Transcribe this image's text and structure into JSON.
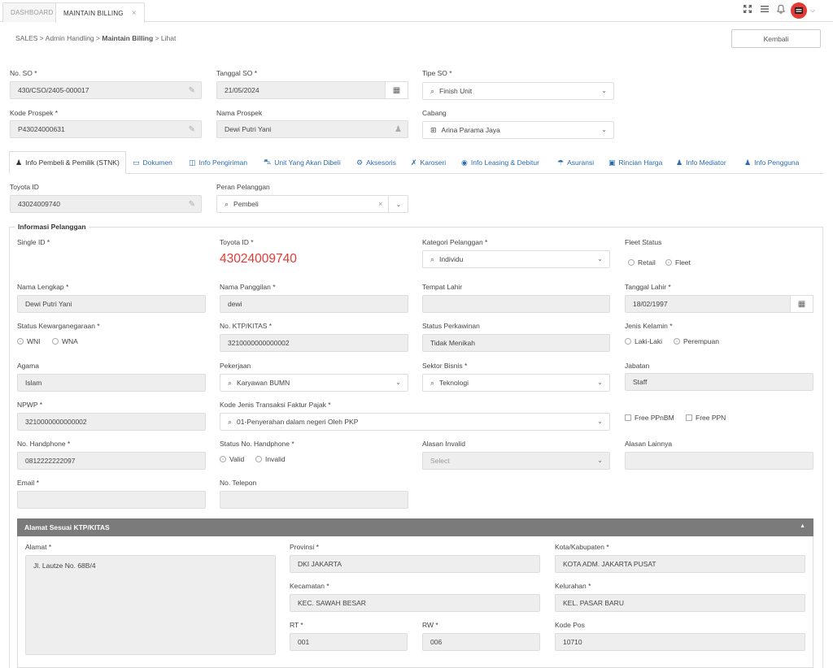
{
  "topbar": {
    "tabs": [
      {
        "label": "DASHBOARD"
      },
      {
        "label": "MAINTAIN BILLING",
        "close": "×"
      }
    ]
  },
  "breadcrumb": {
    "parts": [
      "SALES",
      "Admin Handling",
      "Maintain Billing",
      "Lihat"
    ],
    "sep": ">"
  },
  "actions": {
    "back_label": "Kembali"
  },
  "header": {
    "no_so": {
      "label": "No. SO *",
      "value": "430/CSO/2405-000017"
    },
    "tanggal_so": {
      "label": "Tanggal SO *",
      "value": "21/05/2024"
    },
    "tipe_so": {
      "label": "Tipe SO *",
      "value": "Finish Unit"
    },
    "kode_prospek": {
      "label": "Kode Prospek *",
      "value": "P43024000631"
    },
    "nama_prospek": {
      "label": "Nama Prospek",
      "value": "Dewi Putri Yani"
    },
    "cabang": {
      "label": "Cabang",
      "value": "Arina Parama Jaya"
    }
  },
  "tabs": [
    {
      "label": "Info Pembeli & Pemilik (STNK)",
      "icon": "user-icon"
    },
    {
      "label": "Dokumen",
      "icon": "folder-icon"
    },
    {
      "label": "Info Pengiriman",
      "icon": "map-icon"
    },
    {
      "label": "Unit Yang Akan Dibeli",
      "icon": "car-icon"
    },
    {
      "label": "Aksesoris",
      "icon": "gears-icon"
    },
    {
      "label": "Karoseri",
      "icon": "wrench-icon"
    },
    {
      "label": "Info Leasing & Debitur",
      "icon": "eye-icon"
    },
    {
      "label": "Asuransi",
      "icon": "umbrella-icon"
    },
    {
      "label": "Rincian Harga",
      "icon": "money-icon"
    },
    {
      "label": "Info Mediator",
      "icon": "users-icon"
    },
    {
      "label": "Info Pengguna",
      "icon": "user-icon"
    }
  ],
  "toyota": {
    "toyota_id": {
      "label": "Toyota ID",
      "value": "43024009740"
    },
    "peran": {
      "label": "Peran Pelanggan",
      "value": "Pembeli",
      "clear": "×"
    }
  },
  "info_pelanggan": {
    "legend": "Informasi Pelanggan",
    "single_id": {
      "label": "Single ID *"
    },
    "toyota_id": {
      "label": "Toyota ID *",
      "value": "43024009740"
    },
    "kategori": {
      "label": "Kategori Pelanggan *",
      "value": "Individu"
    },
    "fleet_status": {
      "label": "Fleet Status",
      "options": [
        "Retail",
        "Fleet"
      ],
      "selected": "Fleet"
    },
    "nama_lengkap": {
      "label": "Nama Lengkap *",
      "value": "Dewi Putri Yani"
    },
    "nama_panggilan": {
      "label": "Nama Panggilan *",
      "value": "dewi"
    },
    "tempat_lahir": {
      "label": "Tempat Lahir",
      "value": ""
    },
    "tanggal_lahir": {
      "label": "Tanggal Lahir *",
      "value": "18/02/1997"
    },
    "kewarganegaraan": {
      "label": "Status Kewarganegaraan *",
      "options": [
        "WNI",
        "WNA"
      ],
      "selected": "WNI"
    },
    "ktp": {
      "label": "No. KTP/KITAS *",
      "value": "3210000000000002"
    },
    "perkawinan": {
      "label": "Status Perkawinan",
      "value": "Tidak Menikah"
    },
    "jenis_kelamin": {
      "label": "Jenis Kelamin *",
      "options": [
        "Laki-Laki",
        "Perempuan"
      ],
      "selected": "Perempuan"
    },
    "agama": {
      "label": "Agama",
      "value": "Islam"
    },
    "pekerjaan": {
      "label": "Pekerjaan",
      "value": "Karyawan BUMN"
    },
    "sektor_bisnis": {
      "label": "Sektor Bisnis *",
      "value": "Teknologi"
    },
    "jabatan": {
      "label": "Jabatan",
      "value": "Staff"
    },
    "npwp": {
      "label": "NPWP *",
      "value": "3210000000000002"
    },
    "kode_faktur": {
      "label": "Kode Jenis Transaksi Faktur Pajak *",
      "value": "01-Penyerahan dalam negeri Oleh PKP"
    },
    "free_ppnbm": {
      "label": "Free PPnBM"
    },
    "free_ppn": {
      "label": "Free PPN"
    },
    "handphone": {
      "label": "No. Handphone *",
      "value": "0812222222097"
    },
    "status_hp": {
      "label": "Status No. Handphone *",
      "options": [
        "Valid",
        "Invalid"
      ],
      "selected": "Valid"
    },
    "alasan_invalid": {
      "label": "Alasan Invalid",
      "placeholder": "Select"
    },
    "alasan_lainnya": {
      "label": "Alasan Lainnya",
      "value": ""
    },
    "email": {
      "label": "Email *",
      "value": ""
    },
    "telepon": {
      "label": "No. Telepon",
      "value": ""
    }
  },
  "alamat": {
    "title": "Alamat Sesuai KTP/KITAS",
    "alamat": {
      "label": "Alamat *",
      "value": "Jl. Lautze No. 68B/4"
    },
    "provinsi": {
      "label": "Provinsi *",
      "value": "DKI JAKARTA"
    },
    "kota": {
      "label": "Kota/Kabupaten *",
      "value": "KOTA ADM. JAKARTA PUSAT"
    },
    "kecamatan": {
      "label": "Kecamatan *",
      "value": "KEC. SAWAH BESAR"
    },
    "kelurahan": {
      "label": "Kelurahan *",
      "value": "KEL. PASAR BARU"
    },
    "rt": {
      "label": "RT *",
      "value": "001"
    },
    "rw": {
      "label": "RW *",
      "value": "006"
    },
    "kode_pos": {
      "label": "Kode Pos",
      "value": "10710"
    }
  },
  "colors": {
    "accent": "#2b6cb0",
    "toyota_id_red": "#e53935",
    "panel_head": "#7b7b7b",
    "avatar_red": "#e53935"
  }
}
